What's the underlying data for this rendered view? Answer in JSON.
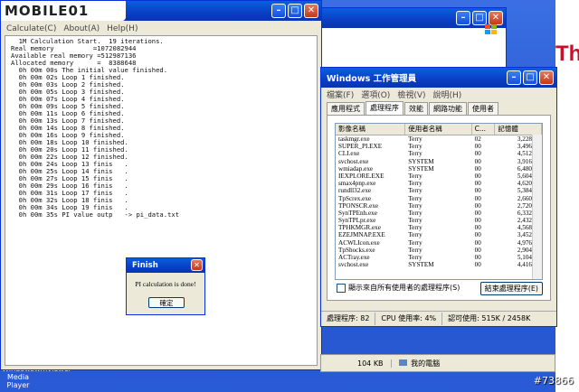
{
  "console": {
    "logo": "MOBILE01",
    "menu": [
      "Calculate(C)",
      "About(A)",
      "Help(H)"
    ],
    "lines": [
      "  1M Calculation Start.  19 iterations.",
      "Real memory          =1072082944",
      "Available real memory =512987136",
      "Allocated memory      =  8388648",
      "  0h 00m 00s The initial value finished.",
      "  0h 00m 02s Loop 1 finished.",
      "  0h 00m 03s Loop 2 finished.",
      "  0h 00m 05s Loop 3 finished.",
      "  0h 00m 07s Loop 4 finished.",
      "  0h 00m 09s Loop 5 finished.",
      "  0h 00m 11s Loop 6 finished.",
      "  0h 00m 13s Loop 7 finished.",
      "  0h 00m 14s Loop 8 finished.",
      "  0h 00m 16s Loop 9 finished.",
      "  0h 00m 18s Loop 10 finished.",
      "  0h 00m 20s Loop 11 finished.",
      "  0h 00m 22s Loop 12 finished.",
      "  0h 00m 24s Loop 13 finis   .",
      "  0h 00m 25s Loop 14 finis   .",
      "  0h 00m 27s Loop 15 finis   .",
      "  0h 00m 29s Loop 16 finis   .",
      "  0h 00m 31s Loop 17 finis   .",
      "  0h 00m 32s Loop 18 finis   .",
      "  0h 00m 34s Loop 19 finis   .",
      "  0h 00m 35s PI value outp   -> pi_data.txt"
    ]
  },
  "taskman": {
    "title": "Windows 工作管理員",
    "menu": [
      "檔案(F)",
      "選項(O)",
      "檢視(V)",
      "說明(H)"
    ],
    "tabs": [
      "應用程式",
      "處理程序",
      "效能",
      "網路功能",
      "使用者"
    ],
    "active_tab": 1,
    "columns": [
      "影像名稱",
      "使用者名稱",
      "C...",
      "記憶體"
    ],
    "processes": [
      [
        "taskmgr.exe",
        "Terry",
        "02",
        "3,228 K"
      ],
      [
        "SUPER_PI.EXE",
        "Terry",
        "00",
        "3,496 K"
      ],
      [
        "CLI.exe",
        "Terry",
        "00",
        "4,512 K"
      ],
      [
        "svchost.exe",
        "SYSTEM",
        "00",
        "3,916 K"
      ],
      [
        "wmiadap.exe",
        "SYSTEM",
        "00",
        "6,480 K"
      ],
      [
        "IEXPLORE.EXE",
        "Terry",
        "00",
        "5,604 K"
      ],
      [
        "smax4pnp.exe",
        "Terry",
        "00",
        "4,620 K"
      ],
      [
        "rundll32.exe",
        "Terry",
        "00",
        "5,384 K"
      ],
      [
        "TpScrex.exe",
        "Terry",
        "00",
        "2,660 K"
      ],
      [
        "TPONSCR.exe",
        "Terry",
        "00",
        "2,720 K"
      ],
      [
        "SynTPEnh.exe",
        "Terry",
        "00",
        "6,332 K"
      ],
      [
        "SynTPLpr.exe",
        "Terry",
        "00",
        "2,432 K"
      ],
      [
        "TPHKMGR.exe",
        "Terry",
        "00",
        "4,568 K"
      ],
      [
        "EZEJMNAP.EXE",
        "Terry",
        "00",
        "3,452 K"
      ],
      [
        "ACWLIcon.exe",
        "Terry",
        "00",
        "4,976 K"
      ],
      [
        "TpShocks.exe",
        "Terry",
        "00",
        "2,904 K"
      ],
      [
        "ACTray.exe",
        "Terry",
        "00",
        "5,104 K"
      ],
      [
        "svchost.exe",
        "SYSTEM",
        "00",
        "4,416 K"
      ]
    ],
    "show_all_label": "顯示來自所有使用者的處理程序(S)",
    "end_process_label": "結束處理程序(E)",
    "status": [
      "處理程序: 82",
      "CPU 使用率: 4%",
      "認可使用: 515K / 2458K"
    ]
  },
  "explorer_strip": [
    "104 KB",
    "我的電腦"
  ],
  "finish": {
    "title": "Finish",
    "message": "PI calculation is done!",
    "ok": "確定"
  },
  "desktop": {
    "icons": [
      "Windows Media Player",
      "wmviewer"
    ],
    "brand": "Thi",
    "watermark": "#73866"
  }
}
